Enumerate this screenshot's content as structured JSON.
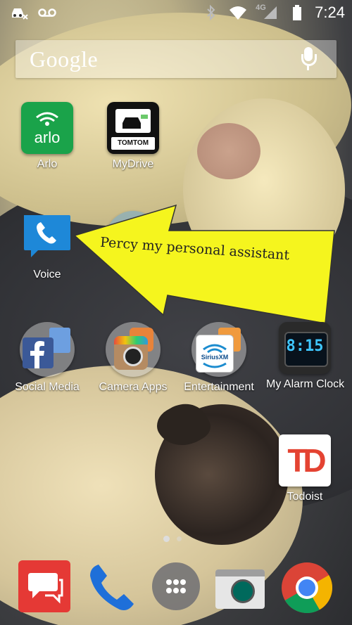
{
  "status_bar": {
    "time": "7:24",
    "network": "4G",
    "left_icons": [
      "car-notification-icon",
      "voicemail-icon"
    ],
    "right_icons": [
      "bluetooth-icon",
      "wifi-icon",
      "cellular-signal-icon",
      "battery-icon"
    ]
  },
  "search": {
    "brand": "Google",
    "mic_icon": "microphone-icon"
  },
  "apps": {
    "arlo": {
      "label": "Arlo",
      "icon_text": "arlo"
    },
    "mydrive": {
      "label": "MyDrive",
      "icon_text": "TOMTOM"
    },
    "voice": {
      "label": "Voice"
    },
    "social_media": {
      "label": "Social Media"
    },
    "camera_apps": {
      "label": "Camera Apps"
    },
    "entertainment": {
      "label": "Entertainment",
      "icon_text": "SiriusXM"
    },
    "alarm_clock": {
      "label": "My Alarm Clock",
      "icon_text": "8:15"
    },
    "todoist": {
      "label": "Todoist",
      "icon_text": "TD"
    }
  },
  "annotation": {
    "text": "Percy my personal assistant",
    "color": "#f5f51e"
  },
  "dock": [
    "messaging-icon",
    "phone-icon",
    "app-drawer-icon",
    "camera-icon",
    "chrome-icon"
  ]
}
